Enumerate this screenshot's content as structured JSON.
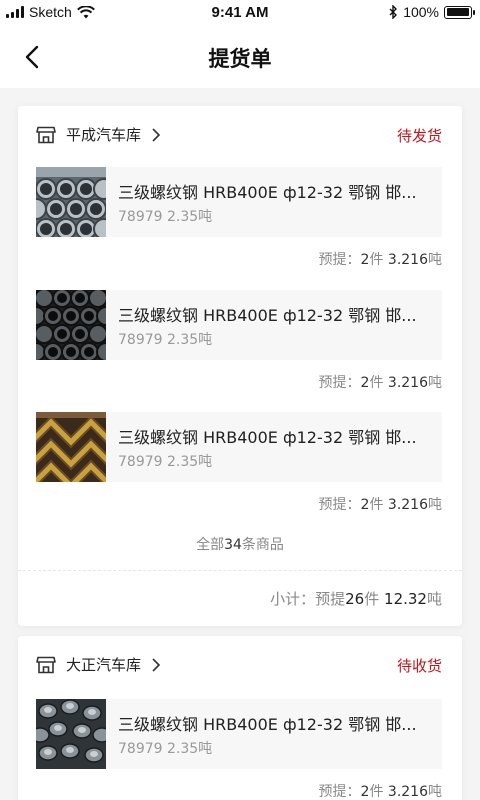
{
  "status_bar": {
    "carrier": "Sketch",
    "time": "9:41 AM",
    "battery": "100%"
  },
  "nav": {
    "title": "提货单"
  },
  "orders": [
    {
      "store": "平成汽车库",
      "status": "待发货",
      "status_color": "#c0161c",
      "items": [
        {
          "name": "三级螺纹钢 HRB400E ф12-32 鄂钢 邯...",
          "spec": "78979 2.35吨",
          "qty_label": "预提：",
          "qty_count": "2",
          "qty_unit": "件",
          "qty_weight": "3.216",
          "weight_unit": "吨",
          "image": "steel-pipes"
        },
        {
          "name": "三级螺纹钢 HRB400E ф12-32 鄂钢 邯...",
          "spec": "78979 2.35吨",
          "qty_label": "预提：",
          "qty_count": "2",
          "qty_unit": "件",
          "qty_weight": "3.216",
          "weight_unit": "吨",
          "image": "black-pipes"
        },
        {
          "name": "三级螺纹钢 HRB400E ф12-32 鄂钢 邯...",
          "spec": "78979 2.35吨",
          "qty_label": "预提：",
          "qty_count": "2",
          "qty_unit": "件",
          "qty_weight": "3.216",
          "weight_unit": "吨",
          "image": "angle-steel"
        }
      ],
      "more": {
        "prefix": "全部",
        "count": "34",
        "suffix": "条商品"
      },
      "subtotal": {
        "label": "小计：",
        "prefix": "预提",
        "count": "26",
        "unit": "件",
        "weight": "12.32",
        "weight_unit": "吨"
      }
    },
    {
      "store": "大正汽车库",
      "status": "待收货",
      "status_color": "#c0161c",
      "items": [
        {
          "name": "三级螺纹钢 HRB400E ф12-32 鄂钢 邯...",
          "spec": "78979 2.35吨",
          "qty_label": "预提：",
          "qty_count": "2",
          "qty_unit": "件",
          "qty_weight": "3.216",
          "weight_unit": "吨",
          "image": "steel-fittings"
        }
      ]
    }
  ]
}
